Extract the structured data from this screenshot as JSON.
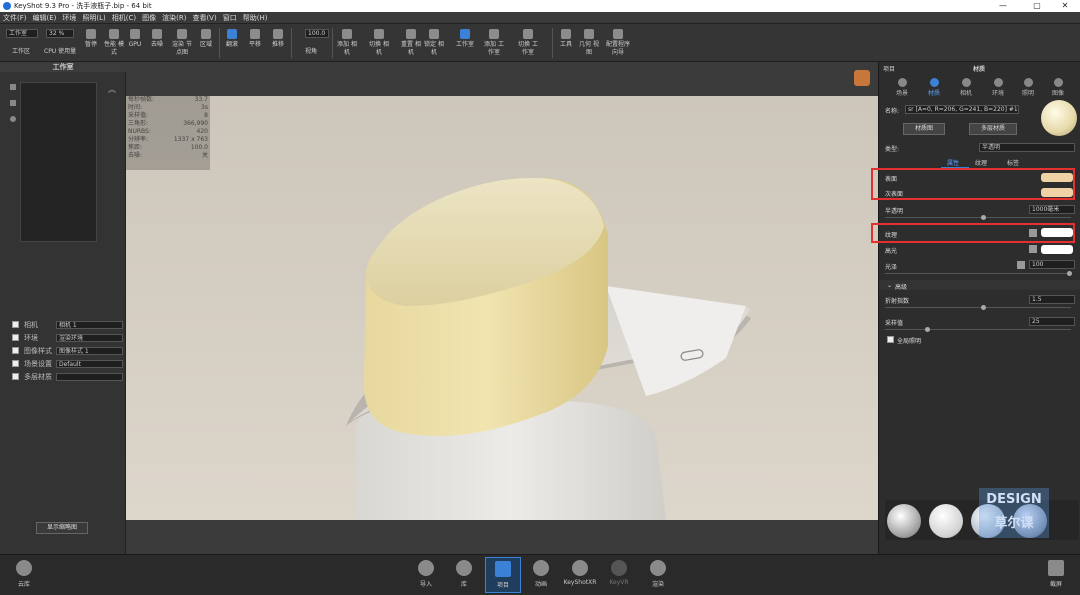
{
  "titlebar": {
    "title": "KeyShot 9.3 Pro - 洗手液瓶子.bip - 64 bit",
    "minimize": "—",
    "restore": "▢",
    "close": "✕"
  },
  "menu": [
    "文件(F)",
    "编辑(E)",
    "环境",
    "照明(L)",
    "相机(C)",
    "图像",
    "渲染(R)",
    "查看(V)",
    "窗口",
    "帮助(H)"
  ],
  "toolbar": {
    "workspace_select": "工作室",
    "workspace_label": "工作区",
    "cpu_value": "32 %",
    "cpu_label": "CPU 使用量",
    "pause": "暂停",
    "perf": "性能\n模式",
    "gpu": "GPU",
    "denoise": "去噪",
    "render_nodes": "渲染\n节点图",
    "region": "区域",
    "refresh": "翻滚",
    "pan": "平移",
    "dolly": "推移",
    "fov_value": "100.0",
    "fov_label": "视角",
    "add_camera": "添加\n相机",
    "switch_camera": "切换\n相机",
    "reset_camera": "重置\n相机",
    "lock_camera": "锁定\n相机",
    "studio": "工作室",
    "add_studio": "添加\n工作室",
    "switch_studio": "切换\n工作室",
    "tools": "工具",
    "geometry_view": "几何\n视图",
    "config_program": "配置程序\n向导"
  },
  "leftpanel": {
    "title": "工作室",
    "rows": [
      {
        "label": "相机",
        "value": "相机 1"
      },
      {
        "label": "环境",
        "value": "渲染环境"
      },
      {
        "label": "图像样式",
        "value": "图像样式 1"
      },
      {
        "label": "场景设置",
        "value": "Default"
      },
      {
        "label": "多层材质",
        "value": ""
      }
    ],
    "bottom_button": "显示缩略图"
  },
  "stats": [
    [
      "每秒帧数:",
      "33.7"
    ],
    [
      "时间:",
      "3s"
    ],
    [
      "采样值:",
      "8"
    ],
    [
      "三角形:",
      "366,990"
    ],
    [
      "NURBS:",
      "420"
    ],
    [
      "分辨率:",
      "1337 x 763"
    ],
    [
      "焦距:",
      "100.0"
    ],
    [
      "去噪:",
      "关"
    ]
  ],
  "rightpanel": {
    "tab_project": "项目",
    "tab_material": "材质",
    "tabs": [
      "场景",
      "材质",
      "相机",
      "环境",
      "照明",
      "图像"
    ],
    "name_label": "名称:",
    "name_value": "sr [A=0, R=206, G=241, B=220] #1",
    "btn_material_graph": "材质图",
    "btn_multi_material": "多层材质",
    "type_label": "类型:",
    "type_value": "半透明",
    "subtabs": [
      "属性",
      "纹理",
      "标签"
    ],
    "props": [
      {
        "label": "表面",
        "color": "#efd3a4"
      },
      {
        "label": "次表面",
        "color": "#efd3a4"
      },
      {
        "label": "半透明",
        "value": "1000毫米"
      },
      {
        "label": "纹理",
        "color": "#ffffff"
      },
      {
        "label": "高光",
        "color": "#ffffff"
      },
      {
        "label": "光泽",
        "value": "100"
      }
    ],
    "advanced_label": "高级",
    "refraction_label": "折射指数",
    "refraction_value": "1.5",
    "samples_label": "采样值",
    "samples_value": "25",
    "global_illum_label": "全局照明"
  },
  "bottombar": {
    "import": "导入",
    "library": "库",
    "project": "项目",
    "animation": "动画",
    "keyshotxr": "KeyShotXR",
    "keyvr": "KeyVR",
    "render": "渲染",
    "cloud": "云库",
    "screenshot": "截屏"
  },
  "watermark": "DESIGN 草尔课"
}
